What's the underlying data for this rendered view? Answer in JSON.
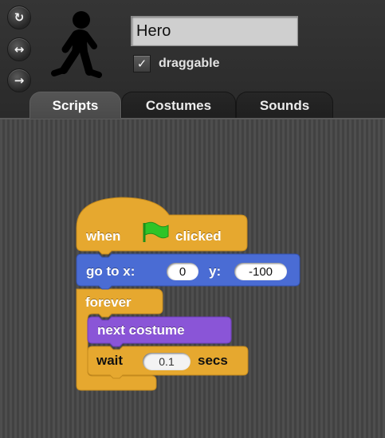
{
  "sprite": {
    "name": "Hero",
    "draggable_label": "draggable",
    "draggable_checked": true,
    "check_glyph": "✓"
  },
  "rotation_buttons": [
    {
      "icon": "rotate-icon",
      "glyph": "↻"
    },
    {
      "icon": "flip-horizontal-icon",
      "glyph": "↔"
    },
    {
      "icon": "no-rotate-icon",
      "glyph": "→"
    }
  ],
  "tabs": [
    {
      "label": "Scripts",
      "active": true
    },
    {
      "label": "Costumes",
      "active": false
    },
    {
      "label": "Sounds",
      "active": false
    }
  ],
  "script": {
    "hat": {
      "before": "when",
      "after": "clicked",
      "icon": "green-flag-icon"
    },
    "goto": {
      "label_x": "go to x:",
      "x_value": "0",
      "label_y": "y:",
      "y_value": "-100"
    },
    "forever": {
      "label": "forever"
    },
    "next_costume": {
      "label": "next costume"
    },
    "wait": {
      "label": "wait",
      "value": "0.1",
      "unit": "secs"
    }
  },
  "colors": {
    "control": "#e6a82f",
    "motion": "#4a6cd4",
    "looks": "#8a55d7",
    "flag": "#2ec427"
  }
}
